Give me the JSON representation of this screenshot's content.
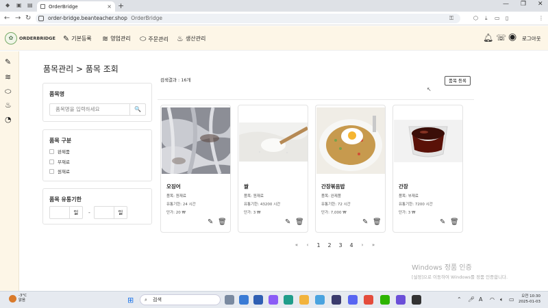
{
  "browser": {
    "tab_title": "OrderBridge",
    "tab_close": "×",
    "new_tab": "+",
    "url": "order-bridge.beanteacher.shop",
    "page_title": "OrderBridge",
    "win_minimize": "—",
    "win_maximize": "❐",
    "win_close": "✕"
  },
  "header": {
    "brand": "ORDERBRIDGE",
    "menu": [
      {
        "label": "기본등록",
        "icon": "edit-icon"
      },
      {
        "label": "영업관리",
        "icon": "handshake-icon"
      },
      {
        "label": "주문관리",
        "icon": "pill-icon"
      },
      {
        "label": "생산관리",
        "icon": "pot-icon"
      }
    ],
    "logout": "로그아웃"
  },
  "page": {
    "title": "품목관리 > 품목 조회"
  },
  "filters": {
    "name_title": "품목명",
    "name_placeholder": "품목명을 입력하세요",
    "search_icon": "🔍",
    "type_title": "품목 구분",
    "type_options": [
      "완제품",
      "부재료",
      "원재료"
    ],
    "expiry_title": "품목 유통기한",
    "from_unit": "일",
    "to_unit": "일",
    "range_sep": "-"
  },
  "results": {
    "count_text": "검색결과 : 16개",
    "register_button": "품목 등록"
  },
  "items": [
    {
      "name": "오징어",
      "type": "품목: 원재료",
      "expiry": "유통기한: 24 시간",
      "price": "단가: 20 ₩"
    },
    {
      "name": "쌀",
      "type": "품목: 원재료",
      "expiry": "유통기한: 43200 시간",
      "price": "단가: 3 ₩"
    },
    {
      "name": "간장볶음밥",
      "type": "품목: 완제품",
      "expiry": "유통기한: 72 시간",
      "price": "단가: 7,000 ₩"
    },
    {
      "name": "간장",
      "type": "품목: 부재료",
      "expiry": "유통기한: 7200 시간",
      "price": "단가: 3 ₩"
    }
  ],
  "pagination": {
    "first": "«",
    "prev": "‹",
    "pages": [
      "1",
      "2",
      "3",
      "4"
    ],
    "next": "›",
    "last": "»"
  },
  "watermark": {
    "line1": "Windows 정품 인증",
    "line2": "[설정]으로 이동하여 Windows를 정품 인증합니다."
  },
  "taskbar": {
    "temp": "-3°C",
    "weather": "맑음",
    "search": "검색",
    "time": "오전 10:30",
    "date": "2025-01-03",
    "lang": "A"
  },
  "colors": {
    "header_bg": "#fdf6e7",
    "rail_bg": "#fdf6e7"
  }
}
